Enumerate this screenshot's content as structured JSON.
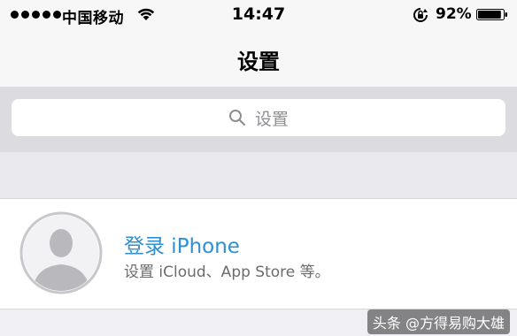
{
  "status_bar": {
    "carrier": "中国移动",
    "time": "14:47",
    "battery_percent": "92%",
    "battery_level": 0.92,
    "icons": [
      "signal-dots-icon",
      "wifi-icon",
      "rotation-lock-icon",
      "battery-icon"
    ]
  },
  "nav": {
    "title": "设置"
  },
  "search": {
    "placeholder": "设置",
    "icon": "search-icon"
  },
  "profile": {
    "title": "登录 iPhone",
    "subtitle": "设置 iCloud、App Store 等。",
    "avatar_icon": "person-silhouette-icon"
  },
  "watermark": {
    "text": "头条 @方得易购大雄"
  },
  "colors": {
    "link_blue": "#2f8fcf",
    "background": "#efeff4",
    "search_band": "#dcdce0"
  }
}
